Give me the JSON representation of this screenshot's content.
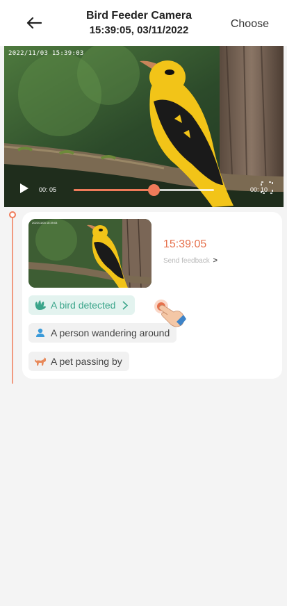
{
  "header": {
    "title": "Bird Feeder Camera",
    "subtitle": "15:39:05, 03/11/2022",
    "choose_label": "Choose",
    "back_icon": "arrow-left-icon"
  },
  "video": {
    "timestamp_overlay": "2022/11/03 15:39:03",
    "current_time": "00: 05",
    "end_time": "00: 10",
    "progress": 0.57,
    "play_icon": "play-icon",
    "fullscreen_icon": "fullscreen-icon"
  },
  "event": {
    "thumb_timestamp": "2022/11/03 15:39:03",
    "time": "15:39:05",
    "feedback_label": "Send feedback",
    "feedback_chevron": ">",
    "tags": [
      {
        "label": "A bird detected",
        "icon": "bird-hand-icon",
        "color": "#3aa58a"
      },
      {
        "label": "A person wandering around",
        "icon": "person-icon",
        "color": "#3b9ad9"
      },
      {
        "label": "A pet passing by",
        "icon": "pet-icon",
        "color": "#e8895a"
      }
    ]
  },
  "colors": {
    "accent": "#e6704b",
    "bird_tag": "#3aa58a",
    "timeline": "#f19a80"
  }
}
